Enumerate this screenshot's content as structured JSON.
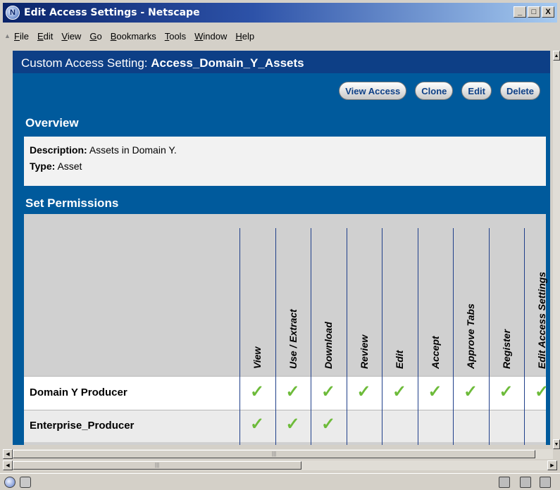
{
  "window": {
    "title": "Edit Access Settings - Netscape",
    "min": "_",
    "max": "□",
    "close": "X",
    "app_icon": "netscape-icon"
  },
  "menu": [
    "File",
    "Edit",
    "View",
    "Go",
    "Bookmarks",
    "Tools",
    "Window",
    "Help"
  ],
  "header": {
    "prefix": "Custom Access Setting: ",
    "name": "Access_Domain_Y_Assets"
  },
  "buttons": {
    "view_access": "View Access",
    "clone": "Clone",
    "edit": "Edit",
    "delete": "Delete"
  },
  "overview": {
    "heading": "Overview",
    "description_label": "Description:",
    "description_value": "Assets in Domain Y.",
    "type_label": "Type:",
    "type_value": "Asset"
  },
  "permissions": {
    "heading": "Set Permissions",
    "columns": [
      "View",
      "Use / Extract",
      "Download",
      "Review",
      "Edit",
      "Accept",
      "Approve Tabs",
      "Register",
      "Edit Access Settings"
    ],
    "check_glyph": "✓",
    "rows": [
      {
        "label": "Domain Y Producer",
        "checks": [
          true,
          true,
          true,
          true,
          true,
          true,
          true,
          true,
          true
        ]
      },
      {
        "label": "Enterprise_Producer",
        "checks": [
          true,
          true,
          true,
          false,
          false,
          false,
          false,
          false,
          false
        ]
      }
    ]
  },
  "colors": {
    "accent": "#005a9c",
    "header_bar": "#0d3f86",
    "check": "#6dbb3a"
  }
}
